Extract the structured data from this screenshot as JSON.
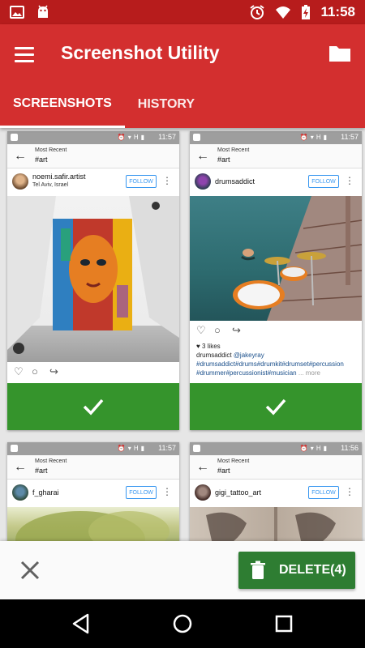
{
  "status_bar": {
    "time": "11:58",
    "left_icons": [
      "image-notification-icon",
      "android-icon"
    ],
    "right_icons": [
      "alarm-icon",
      "wifi-icon",
      "battery-charging-icon"
    ]
  },
  "app_bar": {
    "title": "Screenshot Utility",
    "menu_icon": "hamburger-menu-icon",
    "folder_icon": "folder-icon",
    "color": "#d32f2f"
  },
  "tabs": [
    {
      "label": "SCREENSHOTS",
      "active": true
    },
    {
      "label": "HISTORY",
      "active": false
    }
  ],
  "screenshots": [
    {
      "time": "11:57",
      "nav_title": "Most Recent",
      "nav_subtitle": "#art",
      "username": "noemi.safir.artist",
      "location": "Tel Aviv, Israel",
      "follow_label": "FOLLOW",
      "selected": true
    },
    {
      "time": "11:57",
      "nav_title": "Most Recent",
      "nav_subtitle": "#art",
      "username": "drumsaddict",
      "location": "",
      "follow_label": "FOLLOW",
      "likes": "♥ 3 likes",
      "caption_user": "drumsaddict",
      "caption_mention": "@jakeyray",
      "caption_tags": "#drumsaddict#drums#drumkit#drumset#percussion #drummer#percussionist#musician",
      "caption_more": "... more",
      "selected": true
    },
    {
      "time": "11:57",
      "nav_title": "Most Recent",
      "nav_subtitle": "#art",
      "username": "f_gharai",
      "location": "",
      "follow_label": "FOLLOW",
      "selected": false
    },
    {
      "time": "11:56",
      "nav_title": "Most Recent",
      "nav_subtitle": "#art",
      "username": "gigi_tattoo_art",
      "location": "",
      "follow_label": "FOLLOW",
      "selected": false
    }
  ],
  "action_bar": {
    "close_icon": "close-icon",
    "delete_label": "DELETE(4)",
    "delete_icon": "trash-icon",
    "delete_color": "#2e7d32"
  },
  "selection_color": "#2e9125"
}
